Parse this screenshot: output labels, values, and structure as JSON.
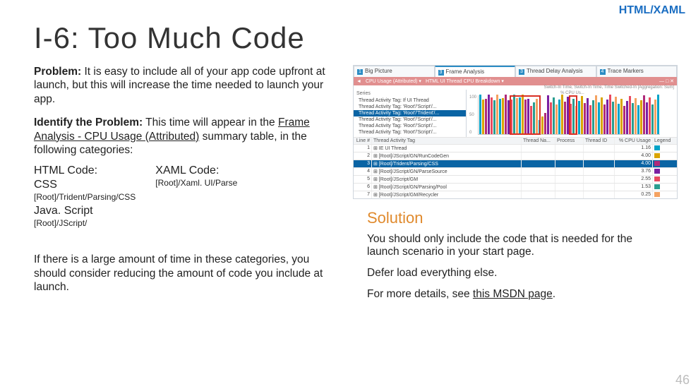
{
  "tag": "HTML/XAML",
  "title": "I-6: Too Much Code",
  "problem_label": "Problem:",
  "problem_text": " It is easy to include all of your app code upfront at launch, but this will increase the time needed to launch your app.",
  "identify_label": "Identify the Problem:",
  "identify_text_1": " This time will appear in the ",
  "identify_link": "Frame Analysis - CPU Usage (Attributed)",
  "identify_text_2": " summary table, in the following categories:",
  "html_code_label": "HTML Code:",
  "css_label": "CSS",
  "css_path": "[Root]/Trident/Parsing/CSS",
  "js_label": "Java. Script",
  "js_path": "[Root]/JScript/",
  "xaml_code_label": "XAML Code:",
  "xaml_path": "[Root]/Xaml. UI/Parse",
  "closing_text": "If there is a large amount of time in these categories, you should consider reducing the amount of code you include at launch.",
  "profiler": {
    "tabs": [
      {
        "n": "1",
        "label": "Big Picture"
      },
      {
        "n": "3",
        "label": "Frame Analysis"
      },
      {
        "n": "3",
        "label": "Thread Delay Analysis"
      },
      {
        "n": "4",
        "label": "Trace Markers"
      }
    ],
    "toolbar": {
      "mode": "CPU Usage (Attributed)",
      "view": "HTML UI Thread CPU Breakdown"
    },
    "legend_right": "Switch-In Time, Switch-In Time, Time Switched-In [Aggregation: Sum]",
    "axis_title": "% CPU Us...",
    "axis_ticks": [
      "100",
      "50",
      "0"
    ],
    "series_title": "Series",
    "series": [
      {
        "label": "Thread Activity Tag: If UI Thread",
        "sel": false
      },
      {
        "label": "Thread Activity Tag: 'Root'/'Script'/...",
        "sel": false
      },
      {
        "label": "Thread Activity Tag: 'Root'/'Trident'/...",
        "sel": true
      },
      {
        "label": "Thread Activity Tag: 'Root'/'Script'/...",
        "sel": false
      },
      {
        "label": "Thread Activity Tag: 'Root'/'Script'/...",
        "sel": false
      },
      {
        "label": "Thread Activity Tag: 'Root'/'Script'/...",
        "sel": false
      }
    ],
    "grid_head": {
      "line": "Line #",
      "tag": "Thread Activity Tag",
      "tn": "Thread Na...",
      "pr": "Process",
      "tid": "Thread ID",
      "cpu": "% CPU Usage",
      "leg": "Legend"
    },
    "rows": [
      {
        "line": "1",
        "tag": "IE UI Thread",
        "cpu": "1.16",
        "color": "#00a3c7"
      },
      {
        "line": "2",
        "tag": "[Root]/JScript/GN/RunCodeGen",
        "cpu": "4.00",
        "color": "#d9a400"
      },
      {
        "line": "3",
        "tag": "[Root]/Trident/Parsing/CSS",
        "sel": true,
        "cpu": "4.00",
        "color": "#b02a7a"
      },
      {
        "line": "4",
        "tag": "[Root]/JScript/GN/ParseSource",
        "cpu": "3.76",
        "color": "#7a1fa2"
      },
      {
        "line": "5",
        "tag": "[Root]/JScript/GM",
        "cpu": "2.55",
        "color": "#e84a5f"
      },
      {
        "line": "6",
        "tag": "[Root]/JScript/GN/Parsing/Pool",
        "cpu": "1.53",
        "color": "#2a9d8f"
      },
      {
        "line": "7",
        "tag": "[Root]/JScript/GM/Recycler",
        "cpu": "0.25",
        "color": "#f4a261"
      }
    ],
    "bar_colors": [
      "#00a3c7",
      "#d9a400",
      "#b02a7a",
      "#7a1fa2",
      "#e84a5f",
      "#2a9d8f",
      "#f4a261"
    ]
  },
  "solution": {
    "heading": "Solution",
    "p1": "You should only include the code that is needed for the launch scenario in your start page.",
    "p2": "Defer load everything else.",
    "p3a": "For more details, see ",
    "p3link": "this MSDN page",
    "p3b": "."
  },
  "page_num": "46"
}
